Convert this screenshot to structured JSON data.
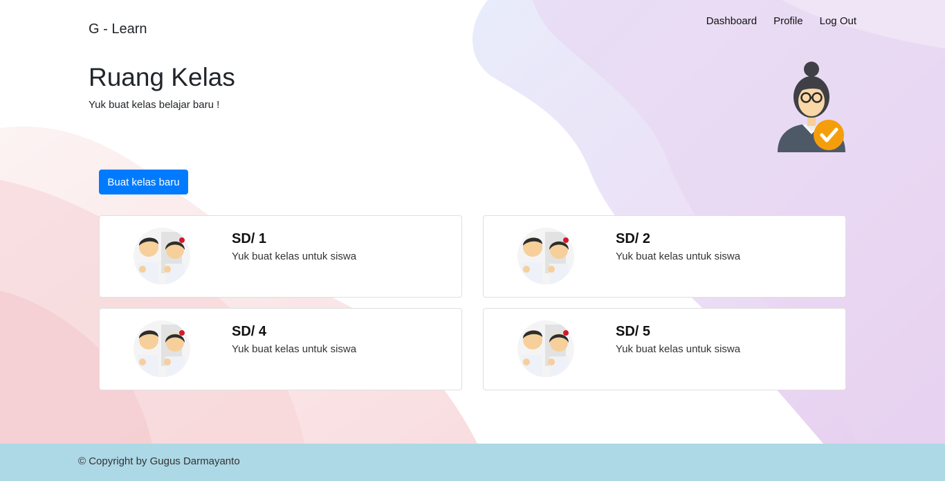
{
  "navbar": {
    "brand": "G - Learn",
    "links": [
      "Dashboard",
      "Profile",
      "Log Out"
    ]
  },
  "hero": {
    "title": "Ruang Kelas",
    "subtitle": "Yuk buat kelas belajar baru !"
  },
  "actions": {
    "new_class_label": "Buat kelas baru"
  },
  "classes": [
    {
      "title": "SD/ 1",
      "description": "Yuk buat kelas untuk siswa"
    },
    {
      "title": "SD/ 2",
      "description": "Yuk buat kelas untuk siswa"
    },
    {
      "title": "SD/ 4",
      "description": "Yuk buat kelas untuk siswa"
    },
    {
      "title": "SD/ 5",
      "description": "Yuk buat kelas untuk siswa"
    }
  ],
  "footer": {
    "copyright": "© Copyright by Gugus Darmayanto"
  },
  "colors": {
    "primary": "#007bff",
    "footer_bg": "#add8e6",
    "teacher_badge": "#f59e0b"
  },
  "icons": {
    "teacher": "teacher-avatar-icon",
    "class_thumbnail": "students-illustration-icon"
  }
}
